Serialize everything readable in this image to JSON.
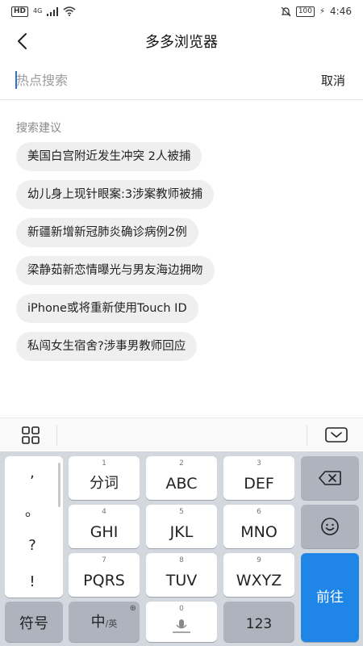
{
  "status_bar": {
    "hd": "HD",
    "network": "4G",
    "battery": "100",
    "time": "4:46"
  },
  "header": {
    "title": "多多浏览器"
  },
  "search": {
    "placeholder": "热点搜索",
    "value": "",
    "cancel_label": "取消"
  },
  "suggestions": {
    "title": "搜索建议",
    "items": [
      "美国白宫附近发生冲突 2人被捕",
      "幼儿身上现针眼案:3涉案教师被捕",
      "新疆新增新冠肺炎确诊病例2例",
      "梁静茹新恋情曝光与男友海边拥吻",
      "iPhone或将重新使用Touch ID",
      "私闯女生宿舍?涉事男教师回应"
    ]
  },
  "keyboard": {
    "punctuation": [
      ",",
      "。",
      "?",
      "!"
    ],
    "keys": {
      "k1": {
        "num": "1",
        "label": "分词"
      },
      "k2": {
        "num": "2",
        "label": "ABC"
      },
      "k3": {
        "num": "3",
        "label": "DEF"
      },
      "k4": {
        "num": "4",
        "label": "GHI"
      },
      "k5": {
        "num": "5",
        "label": "JKL"
      },
      "k6": {
        "num": "6",
        "label": "MNO"
      },
      "k7": {
        "num": "7",
        "label": "PQRS"
      },
      "k8": {
        "num": "8",
        "label": "TUV"
      },
      "k9": {
        "num": "9",
        "label": "WXYZ"
      },
      "k0": {
        "num": "0"
      }
    },
    "symbols_label": "符号",
    "lang_main": "中",
    "lang_alt": "/英",
    "numbers_label": "123",
    "go_label": "前往"
  },
  "icons": {
    "back": "back-arrow-icon",
    "grid": "grid-icon",
    "hide_keyboard": "keyboard-hide-icon",
    "backspace": "backspace-icon",
    "emoji": "emoji-icon",
    "mic": "microphone-icon",
    "globe": "globe-icon"
  },
  "colors": {
    "accent": "#1f86e8",
    "chip_bg": "#efefef",
    "keyboard_bg": "#d3d7de"
  }
}
